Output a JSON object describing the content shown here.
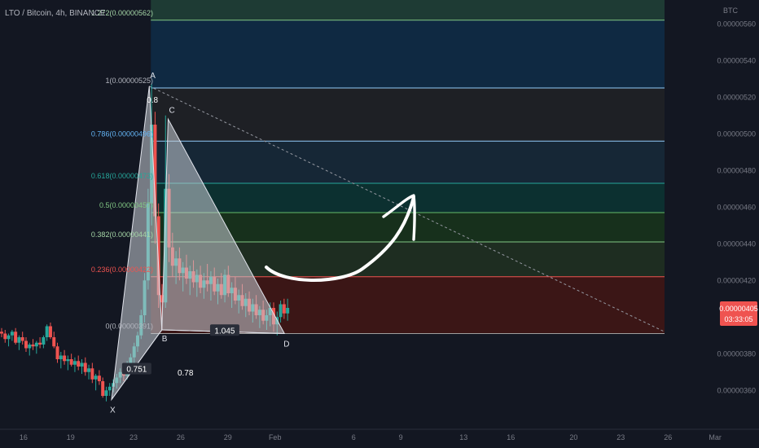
{
  "header": {
    "symbol_title": "LTO / Bitcoin, 4h, BINANCE"
  },
  "price_axis": {
    "currency": "BTC",
    "ticks": [
      {
        "value": 5.6e-06,
        "label": "0.00000560"
      },
      {
        "value": 5.4e-06,
        "label": "0.00000540"
      },
      {
        "value": 5.2e-06,
        "label": "0.00000520"
      },
      {
        "value": 5e-06,
        "label": "0.00000500"
      },
      {
        "value": 4.8e-06,
        "label": "0.00000480"
      },
      {
        "value": 4.6e-06,
        "label": "0.00000460"
      },
      {
        "value": 4.4e-06,
        "label": "0.00000440"
      },
      {
        "value": 4.2e-06,
        "label": "0.00000420"
      },
      {
        "value": 3.8e-06,
        "label": "0.00000380"
      },
      {
        "value": 3.6e-06,
        "label": "0.00000360"
      }
    ],
    "current_price": {
      "value": 4.05e-06,
      "label": "0.00000405",
      "countdown": "03:33:05",
      "color": "#ef5350"
    }
  },
  "time_axis": {
    "ticks": [
      {
        "day": 16,
        "label": "16"
      },
      {
        "day": 19,
        "label": "19"
      },
      {
        "day": 23,
        "label": "23"
      },
      {
        "day": 26,
        "label": "26"
      },
      {
        "day": 29,
        "label": "29"
      },
      {
        "day": 32,
        "label": "Feb"
      },
      {
        "day": 37,
        "label": "6"
      },
      {
        "day": 40,
        "label": "9"
      },
      {
        "day": 44,
        "label": "13"
      },
      {
        "day": 47,
        "label": "16"
      },
      {
        "day": 51,
        "label": "20"
      },
      {
        "day": 54,
        "label": "23"
      },
      {
        "day": 57,
        "label": "26"
      },
      {
        "day": 60,
        "label": "Mar"
      }
    ]
  },
  "fib_levels": [
    {
      "ratio": "1.272",
      "price": 5.62e-06,
      "label": "1.272(0.00000562)",
      "line": "#81c784",
      "fill": "#1e3b34",
      "text": "#a5d6a7"
    },
    {
      "ratio": "1",
      "price": 5.25e-06,
      "label": "1(0.00000525)",
      "line": "#90caf9",
      "fill": "#0f2a44",
      "text": "#b2b5be"
    },
    {
      "ratio": "0.786",
      "price": 4.96e-06,
      "label": "0.786(0.00000496)",
      "line": "#90caf9",
      "fill": "#1f2126",
      "text": "#64b5f6"
    },
    {
      "ratio": "0.618",
      "price": 4.73e-06,
      "label": "0.618(0.00000473)",
      "line": "#26a69a",
      "fill": "#162838",
      "text": "#26a69a"
    },
    {
      "ratio": "0.5",
      "price": 4.57e-06,
      "label": "0.5(0.00000457)",
      "line": "#66bb6a",
      "fill": "#0c3231",
      "text": "#81c784"
    },
    {
      "ratio": "0.382",
      "price": 4.41e-06,
      "label": "0.382(0.00000441)",
      "line": "#81c784",
      "fill": "#17321c",
      "text": "#a5d6a7"
    },
    {
      "ratio": "0.236",
      "price": 4.22e-06,
      "label": "0.236(0.00000422)",
      "line": "#ef5350",
      "fill": "#1f2e22",
      "text": "#ef5350"
    },
    {
      "ratio": "0",
      "price": 3.91e-06,
      "label": "0(0.00000391)",
      "line": "#9e9e9e",
      "fill": "#3d1616",
      "text": "#b2b5be"
    }
  ],
  "harmonic": {
    "points": [
      {
        "name": "X",
        "label": "X",
        "day": 21.6,
        "price": 3.55e-06
      },
      {
        "name": "A",
        "label": "A",
        "day": 24.0,
        "price": 5.26e-06
      },
      {
        "name": "B",
        "label": "B",
        "day": 24.8,
        "price": 3.93e-06
      },
      {
        "name": "C",
        "label": "C",
        "day": 25.2,
        "price": 5.08e-06
      },
      {
        "name": "D",
        "label": "D",
        "day": 32.6,
        "price": 3.91e-06
      }
    ],
    "ratios": [
      {
        "label": "0.751",
        "day": 23.2,
        "price": 3.71e-06,
        "boxed": true
      },
      {
        "label": "0.78",
        "day": 26.3,
        "price": 3.69e-06,
        "boxed": false
      },
      {
        "label": "0.8",
        "day": 24.2,
        "price": 5.18e-06,
        "boxed": false
      },
      {
        "label": "1.045",
        "day": 28.8,
        "price": 3.92e-06,
        "boxed": true
      }
    ]
  },
  "candles": [
    [
      3.92e-06,
      3.94e-06,
      3.89e-06,
      3.91e-06
    ],
    [
      3.91e-06,
      3.93e-06,
      3.86e-06,
      3.88e-06
    ],
    [
      3.88e-06,
      3.91e-06,
      3.84e-06,
      3.9e-06
    ],
    [
      3.9e-06,
      3.93e-06,
      3.87e-06,
      3.92e-06
    ],
    [
      3.92e-06,
      3.94e-06,
      3.85e-06,
      3.86e-06
    ],
    [
      3.86e-06,
      3.9e-06,
      3.82e-06,
      3.89e-06
    ],
    [
      3.89e-06,
      3.92e-06,
      3.85e-06,
      3.87e-06
    ],
    [
      3.87e-06,
      3.89e-06,
      3.81e-06,
      3.83e-06
    ],
    [
      3.83e-06,
      3.86e-06,
      3.79e-06,
      3.85e-06
    ],
    [
      3.85e-06,
      3.88e-06,
      3.82e-06,
      3.84e-06
    ],
    [
      3.84e-06,
      3.87e-06,
      3.8e-06,
      3.86e-06
    ],
    [
      3.86e-06,
      3.89e-06,
      3.83e-06,
      3.85e-06
    ],
    [
      3.85e-06,
      3.9e-06,
      3.83e-06,
      3.89e-06
    ],
    [
      3.89e-06,
      3.96e-06,
      3.87e-06,
      3.95e-06
    ],
    [
      3.95e-06,
      3.97e-06,
      3.88e-06,
      3.89e-06
    ],
    [
      3.89e-06,
      3.92e-06,
      3.83e-06,
      3.84e-06
    ],
    [
      3.84e-06,
      3.86e-06,
      3.75e-06,
      3.77e-06
    ],
    [
      3.77e-06,
      3.81e-06,
      3.72e-06,
      3.79e-06
    ],
    [
      3.79e-06,
      3.82e-06,
      3.74e-06,
      3.76e-06
    ],
    [
      3.76e-06,
      3.79e-06,
      3.71e-06,
      3.77e-06
    ],
    [
      3.77e-06,
      3.8e-06,
      3.73e-06,
      3.74e-06
    ],
    [
      3.74e-06,
      3.78e-06,
      3.7e-06,
      3.76e-06
    ],
    [
      3.76e-06,
      3.79e-06,
      3.71e-06,
      3.73e-06
    ],
    [
      3.73e-06,
      3.77e-06,
      3.69e-06,
      3.75e-06
    ],
    [
      3.75e-06,
      3.78e-06,
      3.68e-06,
      3.7e-06
    ],
    [
      3.7e-06,
      3.74e-06,
      3.66e-06,
      3.72e-06
    ],
    [
      3.72e-06,
      3.75e-06,
      3.64e-06,
      3.66e-06
    ],
    [
      3.66e-06,
      3.69e-06,
      3.6e-06,
      3.68e-06
    ],
    [
      3.68e-06,
      3.71e-06,
      3.63e-06,
      3.65e-06
    ],
    [
      3.65e-06,
      3.67e-06,
      3.56e-06,
      3.57e-06
    ],
    [
      3.57e-06,
      3.62e-06,
      3.54e-06,
      3.6e-06
    ],
    [
      3.6e-06,
      3.64e-06,
      3.57e-06,
      3.62e-06
    ],
    [
      3.62e-06,
      3.66e-06,
      3.59e-06,
      3.64e-06
    ],
    [
      3.64e-06,
      3.69e-06,
      3.61e-06,
      3.67e-06
    ],
    [
      3.67e-06,
      3.72e-06,
      3.64e-06,
      3.7e-06
    ],
    [
      3.7e-06,
      3.74e-06,
      3.65e-06,
      3.68e-06
    ],
    [
      3.68e-06,
      3.76e-06,
      3.66e-06,
      3.74e-06
    ],
    [
      3.74e-06,
      3.8e-06,
      3.71e-06,
      3.78e-06
    ],
    [
      3.78e-06,
      3.86e-06,
      3.75e-06,
      3.84e-06
    ],
    [
      3.84e-06,
      3.92e-06,
      3.81e-06,
      3.9e-06
    ],
    [
      3.9e-06,
      4.04e-06,
      3.88e-06,
      4.01e-06
    ],
    [
      4.01e-06,
      4.24e-06,
      3.97e-06,
      4.2e-06
    ],
    [
      4.2e-06,
      4.7e-06,
      4.15e-06,
      4.62e-06
    ],
    [
      4.62e-06,
      5.27e-06,
      4.5e-06,
      5.05e-06
    ],
    [
      5.05e-06,
      5.12e-06,
      4.4e-06,
      4.55e-06
    ],
    [
      4.55e-06,
      4.62e-06,
      4.05e-06,
      4.12e-06
    ],
    [
      4.12e-06,
      4.18e-06,
      3.93e-06,
      4.08e-06
    ],
    [
      4.08e-06,
      5.1e-06,
      4.05e-06,
      4.7e-06
    ],
    [
      4.7e-06,
      4.78e-06,
      4.3e-06,
      4.38e-06
    ],
    [
      4.38e-06,
      4.46e-06,
      4.22e-06,
      4.28e-06
    ],
    [
      4.28e-06,
      4.36e-06,
      4.18e-06,
      4.32e-06
    ],
    [
      4.32e-06,
      4.38e-06,
      4.2e-06,
      4.24e-06
    ],
    [
      4.24e-06,
      4.3e-06,
      4.14e-06,
      4.27e-06
    ],
    [
      4.27e-06,
      4.34e-06,
      4.18e-06,
      4.21e-06
    ],
    [
      4.21e-06,
      4.28e-06,
      4.12e-06,
      4.25e-06
    ],
    [
      4.25e-06,
      4.31e-06,
      4.16e-06,
      4.19e-06
    ],
    [
      4.19e-06,
      4.26e-06,
      4.11e-06,
      4.23e-06
    ],
    [
      4.23e-06,
      4.28e-06,
      4.13e-06,
      4.16e-06
    ],
    [
      4.16e-06,
      4.24e-06,
      4.1e-06,
      4.2e-06
    ],
    [
      4.2e-06,
      4.29e-06,
      4.14e-06,
      4.18e-06
    ],
    [
      4.18e-06,
      4.25e-06,
      4.09e-06,
      4.22e-06
    ],
    [
      4.22e-06,
      4.27e-06,
      4.12e-06,
      4.14e-06
    ],
    [
      4.14e-06,
      4.21e-06,
      4.07e-06,
      4.18e-06
    ],
    [
      4.18e-06,
      4.24e-06,
      4.1e-06,
      4.12e-06
    ],
    [
      4.12e-06,
      4.26e-06,
      4.08e-06,
      4.23e-06
    ],
    [
      4.23e-06,
      4.28e-06,
      4.11e-06,
      4.13e-06
    ],
    [
      4.13e-06,
      4.19e-06,
      4.05e-06,
      4.16e-06
    ],
    [
      4.16e-06,
      4.22e-06,
      4.07e-06,
      4.09e-06
    ],
    [
      4.09e-06,
      4.15e-06,
      4.02e-06,
      4.12e-06
    ],
    [
      4.12e-06,
      4.18e-06,
      4.04e-06,
      4.06e-06
    ],
    [
      4.06e-06,
      4.13e-06,
      4e-06,
      4.1e-06
    ],
    [
      4.1e-06,
      4.14e-06,
      4.01e-06,
      4.03e-06
    ],
    [
      4.03e-06,
      4.1e-06,
      3.97e-06,
      4.07e-06
    ],
    [
      4.07e-06,
      4.12e-06,
      3.99e-06,
      4.01e-06
    ],
    [
      4.01e-06,
      4.06e-06,
      3.94e-06,
      4.04e-06
    ],
    [
      4.04e-06,
      4.09e-06,
      3.96e-06,
      3.98e-06
    ],
    [
      3.98e-06,
      4.04e-06,
      3.93e-06,
      4.01e-06
    ],
    [
      4.01e-06,
      4.08e-06,
      3.95e-06,
      4.05e-06
    ],
    [
      4.05e-06,
      4.08e-06,
      3.92e-06,
      3.96e-06
    ],
    [
      3.96e-06,
      4.03e-06,
      3.9e-06,
      4e-06
    ],
    [
      4e-06,
      4.09e-06,
      3.97e-06,
      4.07e-06
    ],
    [
      4.07e-06,
      4.1e-06,
      3.99e-06,
      4.02e-06
    ],
    [
      4.02e-06,
      4.1e-06,
      3.98e-06,
      4.05e-06
    ]
  ],
  "colors": {
    "background": "#131722",
    "bull": "#26a69a",
    "bear": "#ef5350",
    "pattern_fill": "#c9ced6",
    "axis_text": "#787b86",
    "annotation_stroke": "#ffffff"
  }
}
